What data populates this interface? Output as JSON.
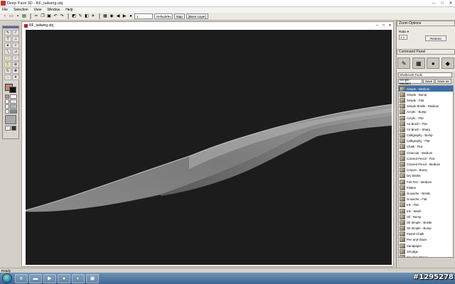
{
  "app": {
    "window_title": "Deep Paint 3D - RF_tailwing.obj",
    "minimize_glyph": "─",
    "maximize_glyph": "□",
    "close_glyph": "✕"
  },
  "menubar": [
    "File",
    "Selection",
    "View",
    "Window",
    "Help"
  ],
  "toolbar": {
    "icons": [
      "new-icon",
      "open-icon",
      "save-icon",
      "print-icon",
      "cut-icon",
      "copy-icon",
      "paste-icon",
      "undo-icon",
      "redo-icon",
      "fill-icon",
      "tool-icon",
      "layers-icon",
      "light-icon",
      "grid-icon",
      "camera-icon",
      "arrow-left-icon",
      "arrow-right-icon",
      "globe-icon"
    ],
    "size_value": "1",
    "material_select": "Default/Bu",
    "map_button": "Map",
    "layer_label": "[Base Layer]"
  },
  "tools_panel": {
    "items": [
      "pen",
      "brush",
      "text",
      "stamp",
      "airbrush",
      "magnifier",
      "line",
      "eyedropper",
      "select",
      "knife",
      "pan",
      "zoom",
      "rotate",
      "move",
      "lasso",
      "wand"
    ],
    "colors": {
      "foreground": "#c48a78",
      "background": "#111111"
    }
  },
  "document": {
    "title": "RF_tailwing.obj",
    "viewport_bg": "#1c1c1c"
  },
  "zoom_options": {
    "panel_title": "Zoom Options",
    "label": "Ratio ▾",
    "value": "1:1",
    "button": "Restore"
  },
  "command_panel": {
    "title": "Command Panel",
    "tabs": [
      "brush-tab-icon",
      "paper-tab-icon",
      "sphere-tab-icon",
      "palette-tab-icon"
    ],
    "brush_select": "Sheibrush Tools",
    "variant_select": "Simple - Medium",
    "save_button": "Save",
    "save_as_button": "Save as",
    "brushes": [
      "Simple - Medium",
      "Simple - Bump",
      "Simple - Flat",
      "Simple Bristle - Medium",
      "Acrylic - Bump",
      "Acrylic - Flat",
      "Air Brush - Flat",
      "Air Brush - Sharp",
      "Calligraphy - Bump",
      "Calligraphy - Flat",
      "Chalk - Flat",
      "Charcoal - Medium",
      "Colored Pencil - Flat",
      "Colored Pencil - Medium",
      "Crayon - Bump",
      "Dry Bristle",
      "Felt Pen - Medium",
      "Flatten",
      "Gouache - Bristle",
      "Gouache - Flat",
      "Ink - Flat",
      "Ink - Wash",
      "Oil - Bump",
      "Oil Simple - Bristle",
      "Oil Simple - Bump",
      "Pastel Chalk",
      "Pen and Glaze",
      "Sandpaper",
      "Smudge",
      "Smudge Finger",
      "Smudge Stick",
      "Tornado",
      "Water Color",
      "Water Color Wash",
      "Wet Edges - Flat"
    ],
    "selected_index": 0
  },
  "status": {
    "text": "Ready"
  },
  "taskbar": {
    "apps": [
      "ie-icon",
      "folder-icon",
      "media-player-icon",
      "firefox-icon",
      "paint-app-icon",
      "photo-app-icon"
    ],
    "watermark": "#1295278"
  }
}
